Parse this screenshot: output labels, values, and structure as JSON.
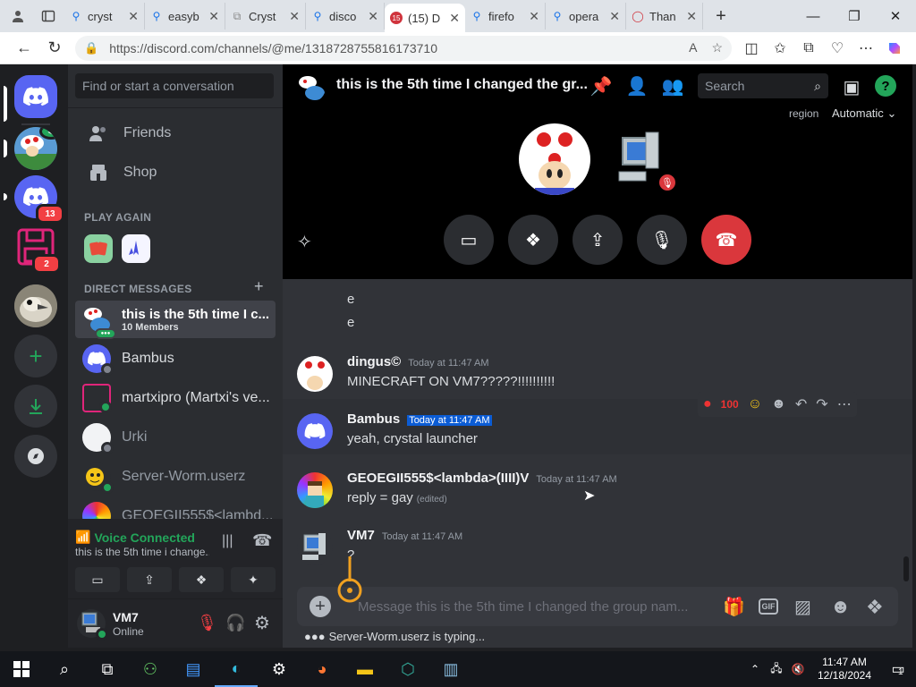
{
  "browser": {
    "tabs": [
      {
        "label": "cryst",
        "icon": "search-icon"
      },
      {
        "label": "easyb",
        "icon": "search-icon"
      },
      {
        "label": "Cryst",
        "icon": "link-icon"
      },
      {
        "label": "disco",
        "icon": "search-icon"
      },
      {
        "label": "(15) D",
        "icon": "discord-icon",
        "badge": "15",
        "active": true
      },
      {
        "label": "firefo",
        "icon": "search-icon"
      },
      {
        "label": "opera",
        "icon": "search-icon"
      },
      {
        "label": "Than",
        "icon": "opera-icon"
      }
    ],
    "url": "https://discord.com/channels/@me/1318728755816173710"
  },
  "guilds": {
    "items": [
      {
        "name": "home",
        "icon": "discord-icon"
      },
      {
        "name": "toad-server",
        "icon": "toad-avatar"
      },
      {
        "name": "discord-server",
        "icon": "discord-icon",
        "badge": "13"
      },
      {
        "name": "floppy-server",
        "icon": "floppy-icon",
        "badge": "2"
      },
      {
        "name": "bird-server",
        "icon": "bird-avatar"
      },
      {
        "name": "add-server",
        "icon": "plus-icon"
      },
      {
        "name": "download-apps",
        "icon": "download-icon"
      },
      {
        "name": "discover",
        "icon": "compass-icon"
      }
    ]
  },
  "sidebar": {
    "search_placeholder": "Find or start a conversation",
    "friends_label": "Friends",
    "shop_label": "Shop",
    "play_again_label": "PLAY AGAIN",
    "dm_label": "DIRECT MESSAGES",
    "dms": [
      {
        "name": "this is the 5th time I c...",
        "sub": "10 Members"
      },
      {
        "name": "Bambus"
      },
      {
        "name": "martxipro (Martxi's ve..."
      },
      {
        "name": "Urki"
      },
      {
        "name": "Server-Worm.userz"
      },
      {
        "name": "GEOEGII555$<lambd..."
      }
    ]
  },
  "voice": {
    "status": "Voice Connected",
    "channel": "this is the 5th time i change..."
  },
  "user": {
    "name": "VM7",
    "status": "Online"
  },
  "call": {
    "title": "this is the 5th time I changed the gr...",
    "search_placeholder": "Search",
    "region_label": "region",
    "region_value": "Automatic"
  },
  "messages": {
    "pre_lines": [
      "e",
      "e"
    ],
    "items": [
      {
        "author": "dingus©",
        "time": "Today at 11:47 AM",
        "content": "MINECRAFT ON VM7?????!!!!!!!!!!"
      },
      {
        "author": "Bambus",
        "time": "Today at 11:47 AM",
        "content": "yeah, crystal launcher"
      },
      {
        "author": "GEOEGII555$<lambda>(IIII)V",
        "time": "Today at 11:47 AM",
        "content": "reply = gay",
        "edited": "(edited)"
      },
      {
        "author": "VM7",
        "time": "Today at 11:47 AM",
        "content": "?"
      }
    ],
    "composer_placeholder": "Message this is the 5th time I changed the group nam...",
    "typing": "Server-Worm.userz is typing..."
  },
  "taskbar": {
    "time": "11:47 AM",
    "date": "12/18/2024",
    "notif": "1"
  },
  "colors": {
    "discord_blurple": "#5865f2",
    "hangup_red": "#da373c",
    "online_green": "#23a55a",
    "mention_highlight": "#0b5cd5"
  }
}
